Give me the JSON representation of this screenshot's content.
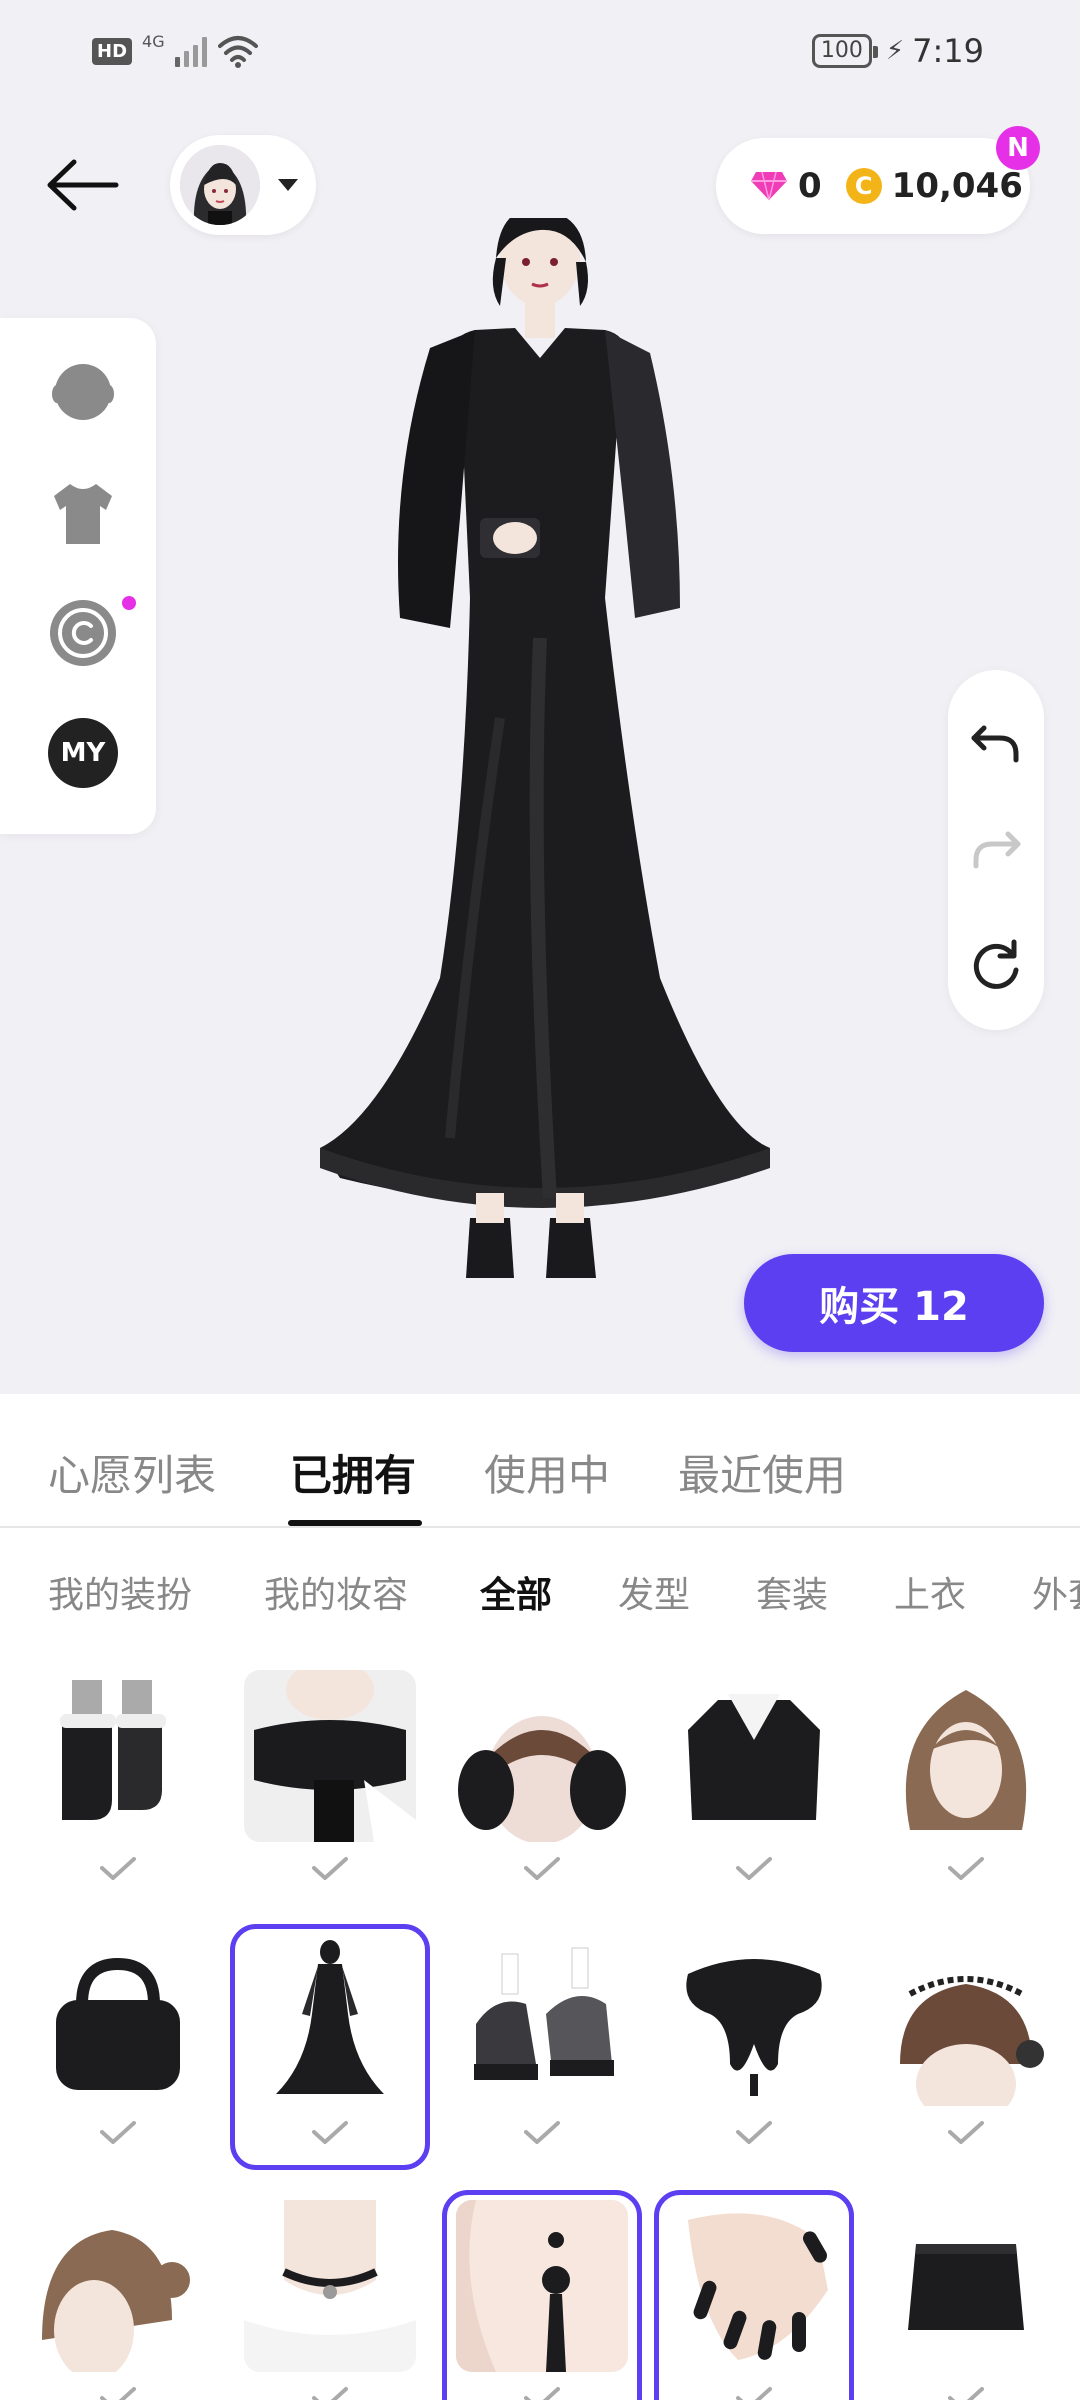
{
  "status_bar": {
    "hd": "HD",
    "network": "4G",
    "battery": "100",
    "time": "7:19"
  },
  "header": {
    "gems": "0",
    "coins": "10,046",
    "new_badge": "N"
  },
  "left_panel": {
    "items": [
      {
        "icon": "head-icon"
      },
      {
        "icon": "shirt-icon"
      },
      {
        "icon": "copyright-icon"
      },
      {
        "label": "MY"
      }
    ]
  },
  "buy_button": {
    "label": "购买 12"
  },
  "main_tabs": [
    {
      "label": "心愿列表"
    },
    {
      "label": "已拥有"
    },
    {
      "label": "使用中"
    },
    {
      "label": "最近使用"
    }
  ],
  "sub_tabs": [
    {
      "label": "我的装扮"
    },
    {
      "label": "我的妆容"
    },
    {
      "label": "全部"
    },
    {
      "label": "发型"
    },
    {
      "label": "套装"
    },
    {
      "label": "上衣"
    },
    {
      "label": "外套"
    }
  ],
  "items": [
    {
      "name": "boots",
      "selected": false
    },
    {
      "name": "scarf",
      "selected": false
    },
    {
      "name": "earmuffs",
      "selected": false
    },
    {
      "name": "jacket",
      "selected": false
    },
    {
      "name": "wavy-hair",
      "selected": false
    },
    {
      "name": "handbag",
      "selected": false
    },
    {
      "name": "black-dress",
      "selected": true
    },
    {
      "name": "platform-shoes",
      "selected": false
    },
    {
      "name": "neck-pillow",
      "selected": false
    },
    {
      "name": "maid-hair",
      "selected": false
    },
    {
      "name": "bun-hair",
      "selected": false
    },
    {
      "name": "choker",
      "selected": false
    },
    {
      "name": "earring",
      "selected": true
    },
    {
      "name": "nails",
      "selected": true
    },
    {
      "name": "skirt",
      "selected": false
    }
  ],
  "colors": {
    "accent": "#5b3ff0",
    "badge": "#e530e8",
    "coin": "#f3b417"
  }
}
